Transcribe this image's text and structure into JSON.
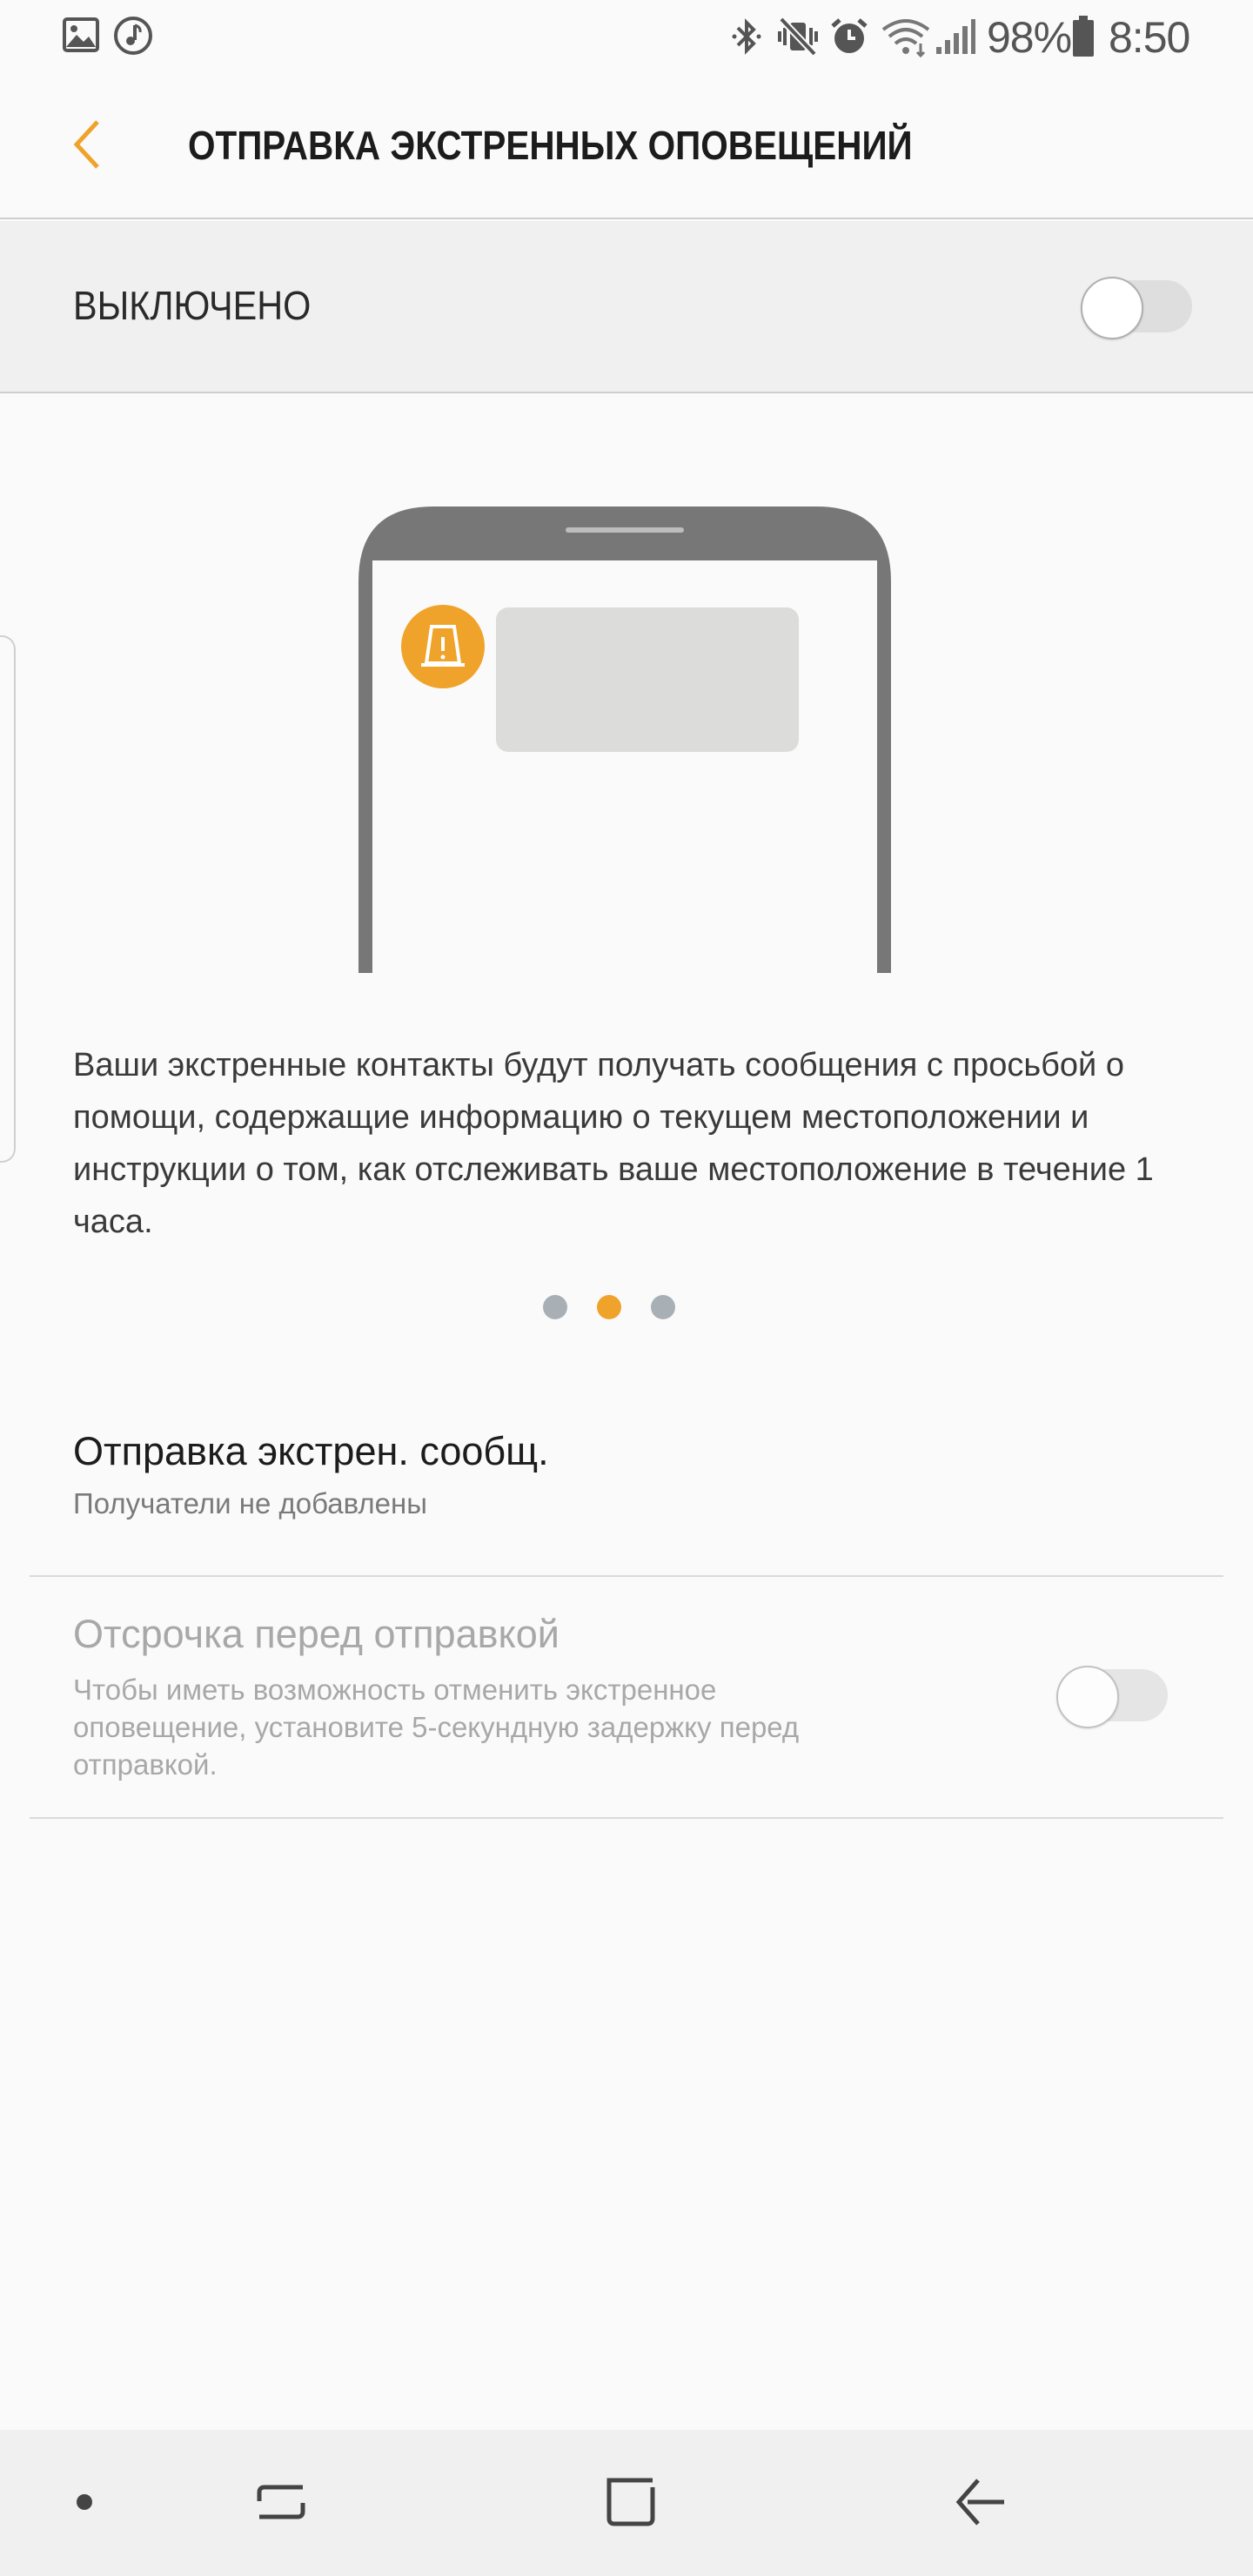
{
  "status_bar": {
    "battery_percent": "98%",
    "time": "8:50"
  },
  "header": {
    "title": "ОТПРАВКА ЭКСТРЕННЫХ ОПОВЕЩЕНИЙ"
  },
  "master_switch": {
    "label": "ВЫКЛЮЧЕНО",
    "on": false
  },
  "intro": {
    "description": "Ваши экстренные контакты будут получать сообщения с просьбой о помощи, содержащие информацию о текущем местоположении и инструкции о том, как отслеживать ваше местоположение в течение 1 часа.",
    "page_count": 3,
    "active_page": 2
  },
  "settings": {
    "send_sos": {
      "title": "Отправка экстрен. сообщ.",
      "summary": "Получатели не добавлены"
    },
    "countdown": {
      "title": "Отсрочка перед отправкой",
      "summary_lines": [
        "Чтобы иметь возможность отменить экстренное",
        "оповещение, установите 5-секундную задержку перед",
        "отправкой."
      ],
      "on": false,
      "enabled": false
    }
  },
  "colors": {
    "accent": "#f0a32b",
    "phone_frame": "#777777",
    "dot_inactive": "#a9b0b5"
  },
  "icons": {
    "status_left": [
      "gallery-icon",
      "music-icon"
    ],
    "status_right": [
      "bluetooth-icon",
      "vibrate-mute-icon",
      "alarm-icon",
      "wifi-icon",
      "signal-icon",
      "battery-icon"
    ],
    "nav": [
      "dot-icon",
      "recents-icon",
      "home-icon",
      "back-arrow-icon"
    ]
  }
}
